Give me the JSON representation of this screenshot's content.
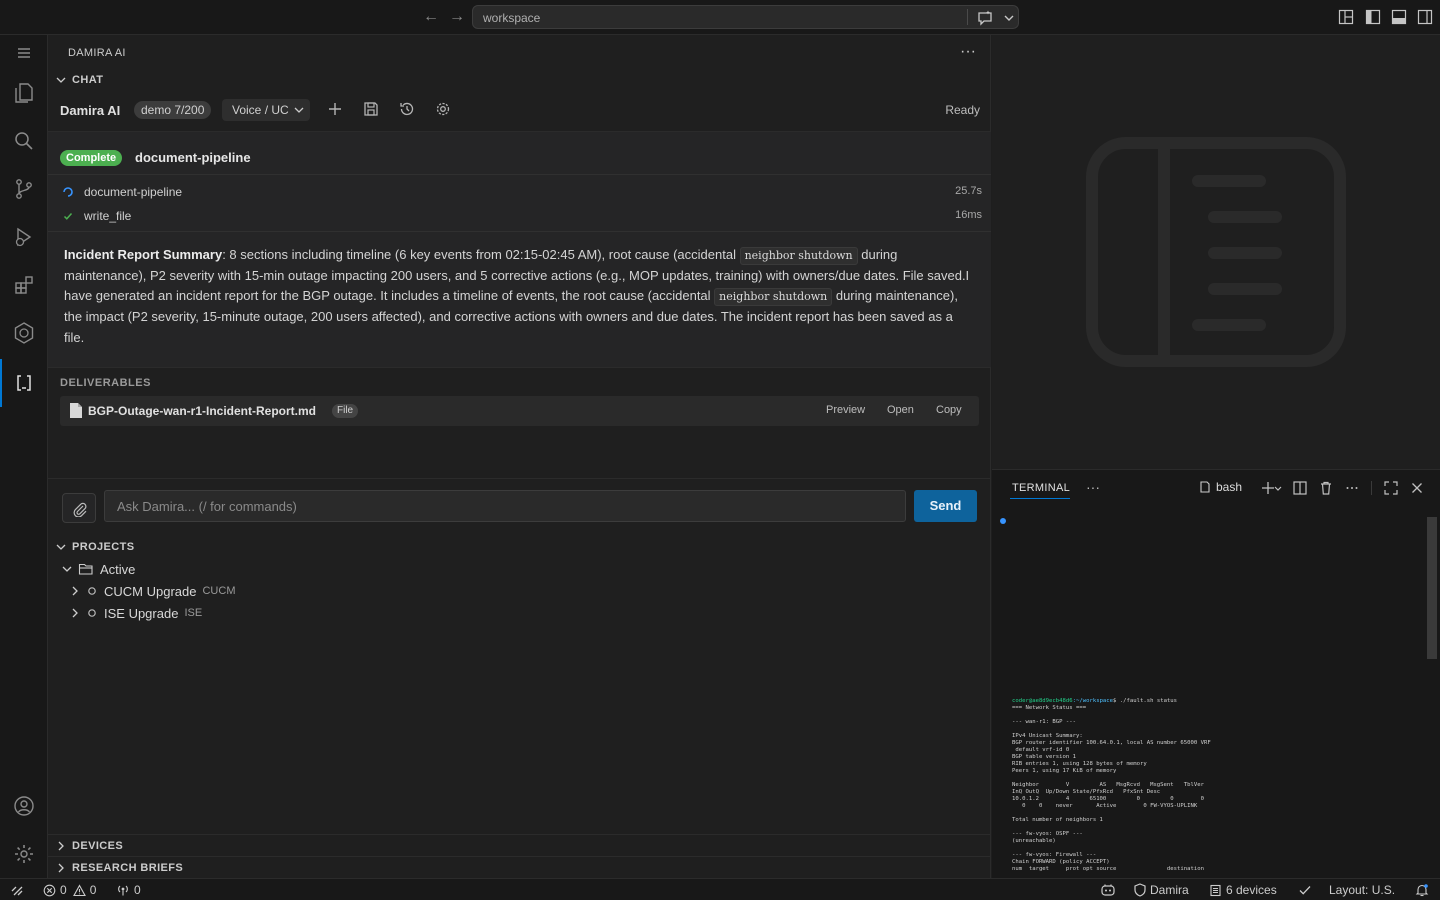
{
  "titlebar": {
    "search_text": "workspace"
  },
  "panel": {
    "title": "DAMIRA AI",
    "chat_section": "CHAT",
    "brand": "Damira AI",
    "demo_badge": "demo 7/200",
    "mode": "Voice / UC",
    "status": "Ready"
  },
  "result": {
    "state_badge": "Complete",
    "title": "document-pipeline",
    "steps": [
      {
        "label": "document-pipeline",
        "time": "25.7s",
        "icon": "spinner-icon"
      },
      {
        "label": "write_file",
        "time": "16ms",
        "icon": "check-icon"
      }
    ],
    "summary": {
      "lead": "Incident Report Summary",
      "p1": ": 8 sections including timeline (6 key events from 02:15-02:45 AM), root cause (accidental ",
      "chip1": "neighbor shutdown",
      "p2": " during maintenance), P2 severity with 15-min outage impacting 200 users, and 5 corrective actions (e.g., MOP updates, training) with owners/due dates. File saved.I have generated an incident report for the BGP outage. It includes a timeline of events, the root cause (accidental ",
      "chip2": "neighbor shutdown",
      "p3": " during maintenance), the impact (P2 severity, 15-minute outage, 200 users affected), and corrective actions with owners and due dates. The incident report has been saved as a file."
    }
  },
  "deliverables": {
    "heading": "DELIVERABLES",
    "items": [
      {
        "name": "BGP-Outage-wan-r1-Incident-Report.md",
        "badge": "File",
        "actions": [
          "Preview",
          "Open",
          "Copy"
        ]
      }
    ]
  },
  "composer": {
    "placeholder": "Ask Damira... (/ for commands)",
    "send_label": "Send"
  },
  "projects": {
    "heading": "PROJECTS",
    "group": "Active",
    "items": [
      {
        "name": "CUCM Upgrade",
        "tag": "CUCM"
      },
      {
        "name": "ISE Upgrade",
        "tag": "ISE"
      }
    ]
  },
  "bottom_sections": [
    "DEVICES",
    "RESEARCH BRIEFS"
  ],
  "terminal": {
    "tab": "TERMINAL",
    "shell": "bash",
    "prompt_user": "coder@ae8d9ecb48d6",
    "prompt_path": ":~/workspace",
    "command": "$ ./fault.sh status",
    "lines": [
      "=== Network Status ===",
      "",
      "--- wan-r1: BGP ---",
      "",
      "IPv4 Unicast Summary:",
      "BGP router identifier 100.64.0.1, local AS number 65000 VRF",
      " default vrf-id 0",
      "BGP table version 1",
      "RIB entries 1, using 128 bytes of memory",
      "Peers 1, using 17 KiB of memory",
      "",
      "Neighbor        V         AS   MsgRcvd   MsgSent   TblVer",
      "InQ OutQ  Up/Down State/PfxRcd   PfxSnt Desc",
      "10.0.1.2        4      65100         0         0        0",
      "   0    0    never       Active        0 FW-VYOS-UPLINK",
      "",
      "Total number of neighbors 1",
      "",
      "--- fw-vyos: OSPF ---",
      "(unreachable)",
      "",
      "--- fw-vyos: Firewall ---",
      "Chain FORWARD (policy ACCEPT)",
      "num  target     prot opt source               destination"
    ]
  },
  "statusbar": {
    "errors": "0",
    "warnings": "0",
    "ports": "0",
    "account": "Damira",
    "devices": "6 devices",
    "layout": "Layout: U.S."
  },
  "colors": {
    "accent": "#0078d4",
    "send": "#0e639c",
    "complete": "#4caf50",
    "background": "#1e1e1e"
  }
}
